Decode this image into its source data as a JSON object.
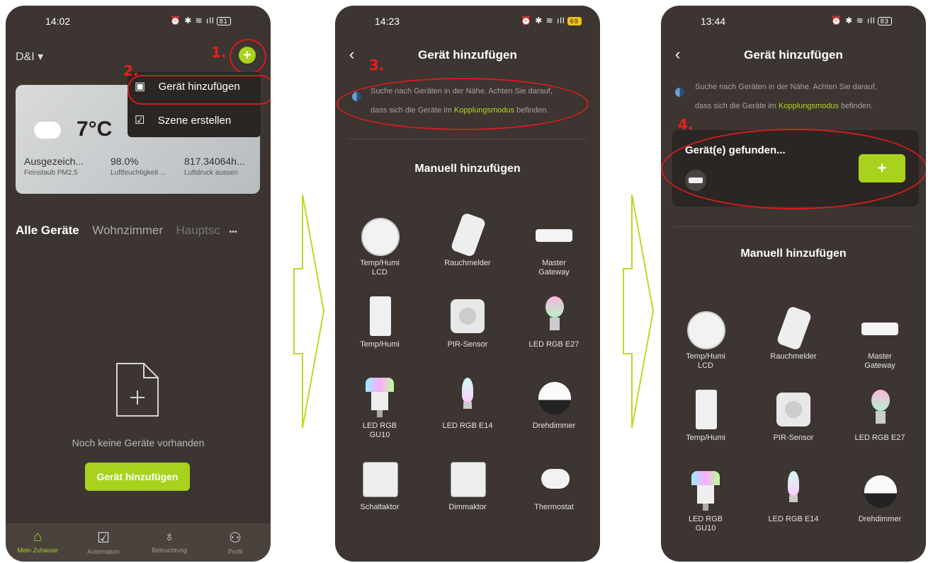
{
  "colors": {
    "accent": "#a8d21e",
    "annotation": "#e5201c",
    "bg": "#3c3531"
  },
  "screen1": {
    "time": "14:02",
    "battery": "81",
    "home": "D&I ▾",
    "step1": "1.",
    "step2": "2.",
    "add_icon": "plus-circle-icon",
    "menu": [
      {
        "label": "Gerät hinzufügen",
        "icon": "device-add-icon"
      },
      {
        "label": "Szene erstellen",
        "icon": "scene-add-icon"
      }
    ],
    "weather": {
      "temp": "7°C",
      "icon": "cloud-icon",
      "stats": [
        {
          "value": "Ausgezeich...",
          "label": "Feinstaub PM2.5"
        },
        {
          "value": "98.0%",
          "label": "Luftfeuchtigkeit ..."
        },
        {
          "value": "817.34064h...",
          "label": "Luftdruck aussen"
        }
      ]
    },
    "tabs": [
      "Alle Geräte",
      "Wohnzimmer",
      "Hauptsc"
    ],
    "more": "•••",
    "empty_text": "Noch keine Geräte vorhanden",
    "add_button": "Gerät hinzufügen",
    "nav": [
      {
        "label": "Mein Zuhause",
        "icon": "home-icon"
      },
      {
        "label": "Automation",
        "icon": "checkbox-icon"
      },
      {
        "label": "Beleuchtung",
        "icon": "bulb-icon"
      },
      {
        "label": "Profil",
        "icon": "profile-icon"
      }
    ]
  },
  "screen2": {
    "time": "14:23",
    "battery": "69",
    "title": "Gerät hinzufügen",
    "step3": "3.",
    "search_text_1": "Suche nach Geräten in der Nähe. Achten Sie darauf,",
    "search_text_2a": "dass sich die Geräte im ",
    "search_link": "Kopplungsmodus",
    "search_text_2b": " befinden.",
    "section": "Manuell hinzufügen",
    "devices": [
      [
        "Temp/Humi",
        "LCD"
      ],
      [
        "Rauchmelder",
        ""
      ],
      [
        "Master",
        "Gateway"
      ],
      [
        "Temp/Humi",
        ""
      ],
      [
        "PIR-Sensor",
        ""
      ],
      [
        "LED RGB E27",
        ""
      ],
      [
        "LED RGB",
        "GU10"
      ],
      [
        "LED RGB E14",
        ""
      ],
      [
        "Drehdimmer",
        ""
      ],
      [
        "Schaltaktor",
        ""
      ],
      [
        "Dimmaktor",
        ""
      ],
      [
        "Thermostat",
        ""
      ]
    ]
  },
  "screen3": {
    "time": "13:44",
    "battery": "83",
    "title": "Gerät hinzufügen",
    "step4": "4.",
    "search_text_1": "Suche nach Geräten in der Nähe. Achten Sie darauf,",
    "search_text_2a": "dass sich die Geräte im ",
    "search_link": "Kopplungsmodus",
    "search_text_2b": " befinden.",
    "found": "Gerät(e) gefunden...",
    "found_add": "+",
    "section": "Manuell hinzufügen",
    "devices": [
      [
        "Temp/Humi",
        "LCD"
      ],
      [
        "Rauchmelder",
        ""
      ],
      [
        "Master",
        "Gateway"
      ],
      [
        "Temp/Humi",
        ""
      ],
      [
        "PIR-Sensor",
        ""
      ],
      [
        "LED RGB E27",
        ""
      ],
      [
        "LED RGB",
        "GU10"
      ],
      [
        "LED RGB E14",
        ""
      ],
      [
        "Drehdimmer",
        ""
      ]
    ]
  }
}
